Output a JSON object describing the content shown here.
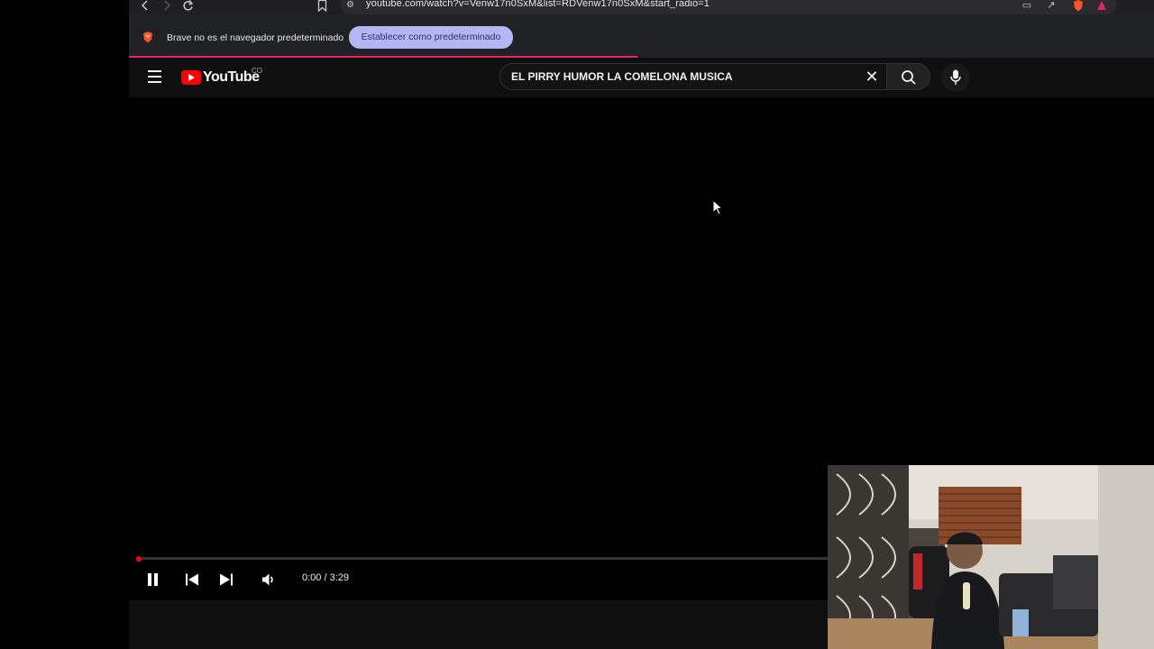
{
  "browser": {
    "url": "youtube.com/watch?v=Venw17n0SxM&list=RDVenw17n0SxM&start_radio=1",
    "infobar": {
      "message": "Brave no es el navegador predeterminado",
      "action_label": "Establecer como predeterminado"
    }
  },
  "youtube": {
    "logo_text": "YouTube",
    "country_code": "CO",
    "search": {
      "query": "EL PIRRY HUMOR LA COMELONA MUSICA"
    },
    "player": {
      "time_display": "0:00 / 3:29",
      "progress": 0.0,
      "accent_color": "#ff0000"
    }
  },
  "icons": {
    "back": "chevron-left-icon",
    "forward": "chevron-right-icon",
    "reload": "reload-icon",
    "bookmark": "bookmark-icon",
    "menu": "hamburger-menu-icon",
    "clear": "close-icon",
    "search": "search-icon",
    "mic": "microphone-icon",
    "pause": "pause-icon",
    "previous": "skip-previous-icon",
    "next": "skip-next-icon",
    "volume": "volume-icon"
  }
}
